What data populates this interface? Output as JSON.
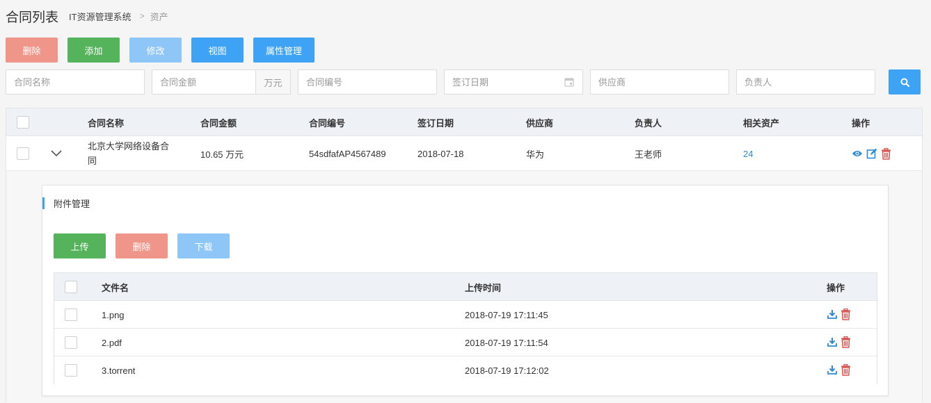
{
  "header": {
    "title": "合同列表",
    "crumb_system": "IT资源管理系统",
    "crumb_sep": ">",
    "crumb_current": "资产"
  },
  "toolbar": {
    "delete_label": "删除",
    "add_label": "添加",
    "edit_label": "修改",
    "view_label": "视图",
    "attr_label": "属性管理"
  },
  "filters": {
    "name_placeholder": "合同名称",
    "amount_placeholder": "合同金额",
    "amount_unit": "万元",
    "number_placeholder": "合同编号",
    "date_placeholder": "签订日期",
    "supplier_placeholder": "供应商",
    "owner_placeholder": "负责人"
  },
  "table": {
    "columns": [
      "合同名称",
      "合同金额",
      "合同编号",
      "签订日期",
      "供应商",
      "负责人",
      "相关资产",
      "操作"
    ],
    "rows": [
      {
        "name_line1": "北京大学网络设备合",
        "name_line2": "同",
        "amount": "10.65 万元",
        "number": "54sdfafAP4567489",
        "date": "2018-07-18",
        "supplier": "华为",
        "owner": "王老师",
        "assets": "24"
      }
    ]
  },
  "attachments": {
    "title": "附件管理",
    "upload_label": "上传",
    "delete_label": "删除",
    "download_label": "下载",
    "columns": [
      "文件名",
      "上传时间",
      "操作"
    ],
    "files": [
      {
        "name": "1.png",
        "time": "2018-07-19 17:11:45"
      },
      {
        "name": "2.pdf",
        "time": "2018-07-19 17:11:54"
      },
      {
        "name": "3.torrent",
        "time": "2018-07-19 17:12:02"
      }
    ]
  },
  "colors": {
    "primary": "#3ea2f5",
    "success": "#55b35b",
    "danger": "#ef958a",
    "disabled": "#8ec6f7",
    "icon_blue": "#2d8ad6",
    "icon_red": "#d9534f"
  },
  "icons": {
    "calendar": "calendar-icon",
    "search": "search-icon",
    "expand": "chevron-down-icon",
    "view": "eye-icon",
    "edit": "edit-icon",
    "delete": "trash-icon",
    "download": "download-icon"
  }
}
